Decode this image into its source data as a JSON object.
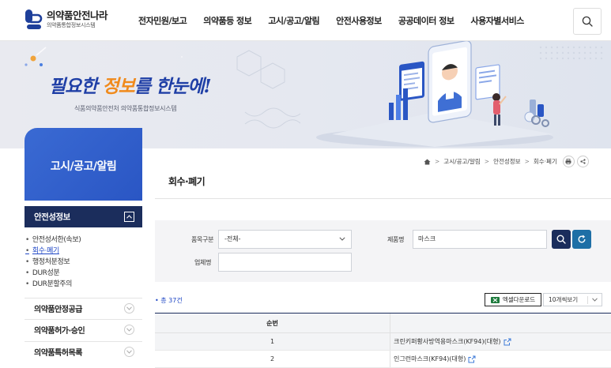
{
  "header": {
    "logo_title": "의약품안전나라",
    "logo_sub": "의약품통합정보시스템",
    "nav": [
      "전자민원/보고",
      "의약품등 정보",
      "고시/공고/알림",
      "안전사용정보",
      "공공데이터 정보",
      "사용자별서비스"
    ]
  },
  "banner": {
    "slogan_part1": "필요한 ",
    "slogan_part2": "정보",
    "slogan_part3": "를 한눈에!",
    "sub": "식품의약품안전처 의약품통합정보시스템"
  },
  "sidebar": {
    "title": "고시/공고/알림",
    "active_section": "안전성정보",
    "sub_items": [
      {
        "label": "안전성서한(속보)",
        "active": false
      },
      {
        "label": "회수·폐기",
        "active": true
      },
      {
        "label": "행정처분정보",
        "active": false
      },
      {
        "label": "DUR성분",
        "active": false
      },
      {
        "label": "DUR분할주의",
        "active": false
      }
    ],
    "menus": [
      "의약품안정공급",
      "의약품허가·승인",
      "의약품특허목록"
    ]
  },
  "breadcrumb": [
    "고시/공고/알림",
    "안전성정보",
    "회수·폐기"
  ],
  "page": {
    "title": "회수·폐기"
  },
  "search": {
    "category_label": "품목구분",
    "category_value": "-전체-",
    "product_label": "제품명",
    "product_value": "마스크",
    "company_label": "업체명",
    "company_value": ""
  },
  "results": {
    "count_text": "총 37건",
    "excel_label": "엑셀다운로드",
    "view_label": "10개씩보기",
    "col_no": "순번",
    "rows": [
      {
        "no": "1",
        "name": "크린키퍼황사방역용마스크(KF94)(대형)"
      },
      {
        "no": "2",
        "name": "인그런마스크(KF94)(대형)"
      }
    ]
  },
  "colors": {
    "primary": "#2a56c4",
    "navy": "#1b2d5c",
    "teal": "#1e6fa6",
    "excel_green": "#1d7a3c"
  }
}
